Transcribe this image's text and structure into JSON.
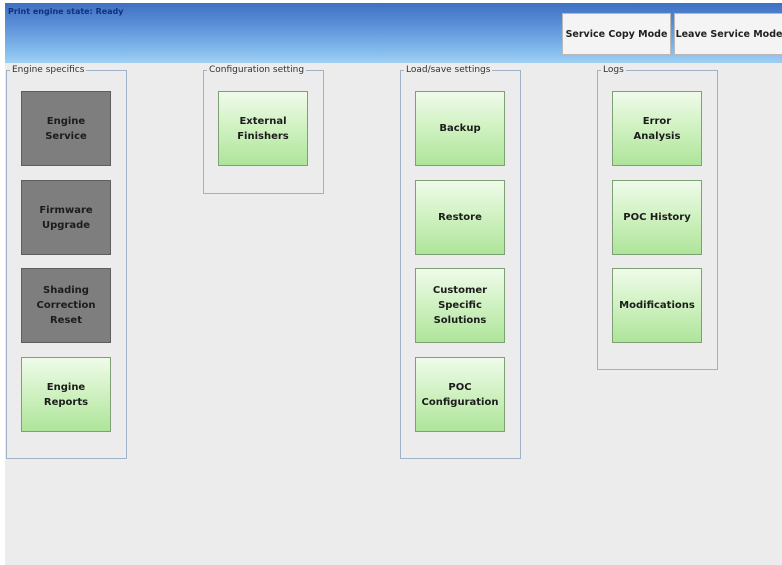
{
  "header": {
    "status": "Print engine state: Ready",
    "service_copy_mode": "Service Copy Mode",
    "leave_service_mode": "Leave Service Mode"
  },
  "groups": {
    "engine_specifics": {
      "label": "Engine specifics",
      "buttons": [
        "Engine\nService",
        "Firmware\nUpgrade",
        "Shading\nCorrection\nReset",
        "Engine\nReports"
      ]
    },
    "configuration_setting": {
      "label": "Configuration setting",
      "buttons": [
        "External\nFinishers"
      ]
    },
    "load_save_settings": {
      "label": "Load/save settings",
      "buttons": [
        "Backup",
        "Restore",
        "Customer\nSpecific\nSolutions",
        "POC\nConfiguration"
      ]
    },
    "logs": {
      "label": "Logs",
      "buttons": [
        "Error\nAnalysis",
        "POC History",
        "Modifications"
      ]
    }
  },
  "colors": {
    "header_top": "#3f6fc2",
    "header_bottom": "#9fd0f3",
    "tile_green": "#c7efb8",
    "tile_disabled": "#7e7e7e",
    "background": "#ececec"
  }
}
